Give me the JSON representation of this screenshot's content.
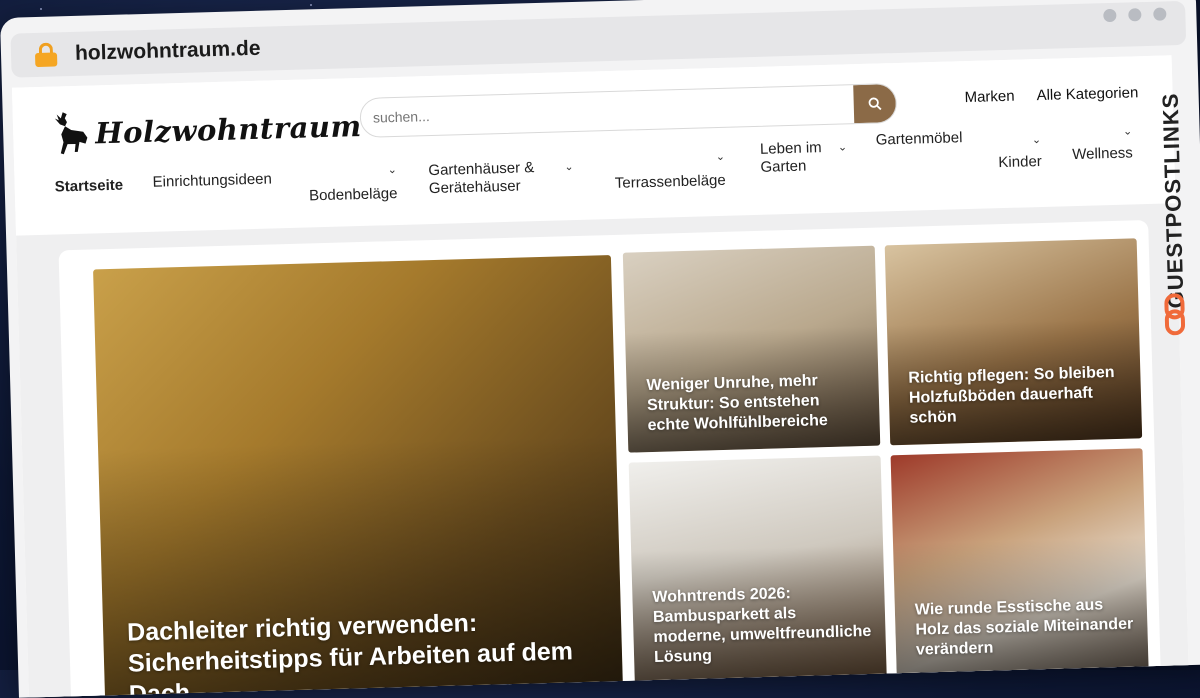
{
  "browser": {
    "url": "holzwohntraum.de"
  },
  "site": {
    "logo_text": "Holzwohntraum",
    "search_placeholder": "suchen...",
    "top_links": [
      "Marken",
      "Alle Kategorien"
    ],
    "nav": [
      {
        "label": "Startseite",
        "active": true,
        "dropdown": false
      },
      {
        "label": "Einrichtungsideen",
        "dropdown": false
      },
      {
        "label": "Bodenbeläge",
        "dropdown": true
      },
      {
        "label": "Gartenhäuser & Gerätehäuser",
        "dropdown": true
      },
      {
        "label": "Terrassenbeläge",
        "dropdown": true
      },
      {
        "label": "Leben im Garten",
        "dropdown": true
      },
      {
        "label": "Gartenmöbel",
        "dropdown": false
      },
      {
        "label": "Kinder",
        "dropdown": true
      },
      {
        "label": "Wellness",
        "dropdown": true
      }
    ]
  },
  "articles": {
    "main": "Dachleiter richtig verwenden: Sicherheitstipps für Arbeiten auf dem Dach",
    "a": "Weniger Unruhe, mehr Struktur: So entstehen echte Wohlfühlbereiche",
    "b": "Richtig pflegen: So bleiben Holzfußböden dauerhaft schön",
    "c": "Wohntrends 2026: Bambusparkett als moderne, umweltfreundliche Lösung",
    "d": "Wie runde Esstische aus Holz das soziale Miteinander verändern"
  },
  "watermark": {
    "text": "GUESTPOSTLINKS"
  },
  "colors": {
    "search_button": "#8b6a47",
    "lock": "#f5a623"
  }
}
